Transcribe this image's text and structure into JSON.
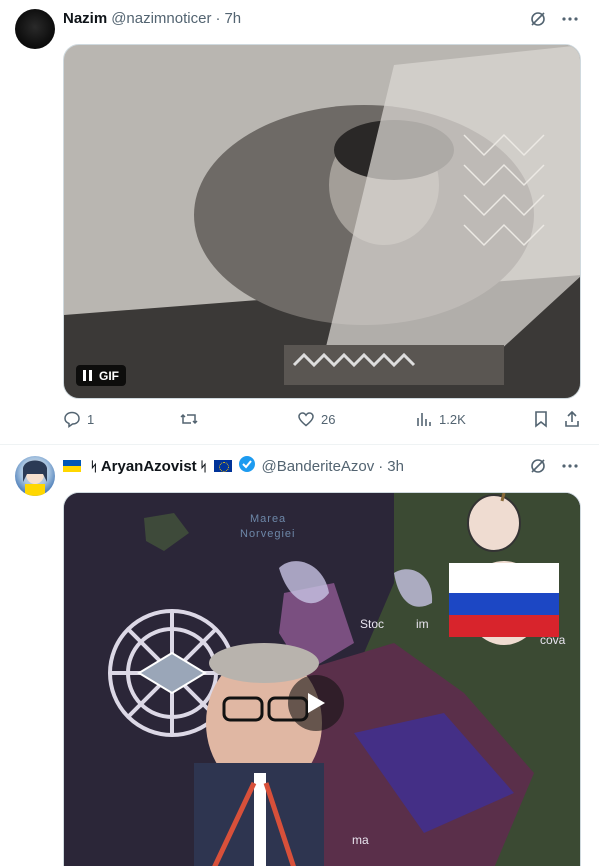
{
  "tweets": [
    {
      "author_name": "Nazim",
      "author_handle": "@nazimnoticer",
      "separator": "·",
      "time": "7h",
      "media": {
        "type": "gif",
        "badge": "GIF"
      },
      "stats": {
        "replies": "1",
        "likes": "26",
        "views": "1.2K"
      }
    },
    {
      "author_prefix_rune": "ᛋ",
      "author_name": "AryanAzovist",
      "author_suffix_rune": "ᛋ",
      "author_handle": "@BanderiteAzov",
      "separator": "·",
      "time": "3h",
      "media": {
        "type": "video",
        "map_labels": [
          "Marea",
          "Norvegiei",
          "Stoc",
          "im",
          "cova",
          "ma"
        ]
      }
    }
  ],
  "colors": {
    "accent": "#1d9bf0",
    "muted": "#536471"
  }
}
